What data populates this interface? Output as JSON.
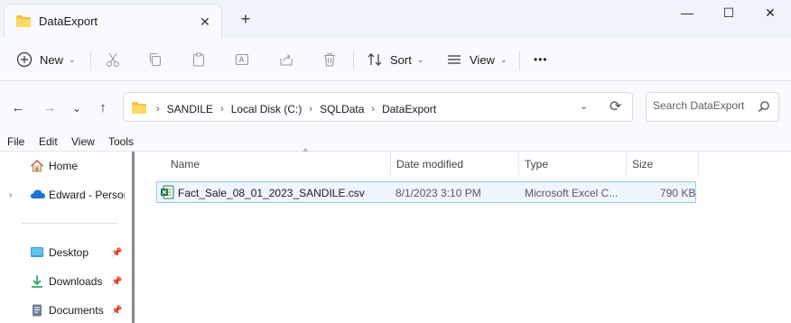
{
  "window": {
    "tab_title": "DataExport",
    "tab_close": "✕",
    "new_tab": "+",
    "minimize": "—",
    "maximize": "☐",
    "close": "✕"
  },
  "command_bar": {
    "new_label": "New",
    "sort_label": "Sort",
    "view_label": "View",
    "more_label": "•••",
    "icons": [
      "plus-circle-icon",
      "cut-icon",
      "copy-icon",
      "paste-icon",
      "rename-icon",
      "share-icon",
      "delete-icon",
      "sort-icon",
      "view-icon"
    ]
  },
  "address": {
    "back": "←",
    "forward": "→",
    "recent": "⌄",
    "up": "↑",
    "crumbs": [
      "SANDILE",
      "Local Disk (C:)",
      "SQLData",
      "DataExport"
    ],
    "dropdown": "⌄",
    "refresh": "⟳",
    "search_placeholder": "Search DataExport"
  },
  "menu": {
    "items": [
      "File",
      "Edit",
      "View",
      "Tools"
    ]
  },
  "nav_pane": {
    "items": [
      {
        "label": "Home",
        "icon": "home-icon"
      },
      {
        "label": "Edward - Persor",
        "icon": "onedrive-cloud-icon"
      },
      {
        "label": "Desktop",
        "icon": "desktop-icon"
      },
      {
        "label": "Downloads",
        "icon": "downloads-icon"
      },
      {
        "label": "Documents",
        "icon": "documents-icon"
      }
    ],
    "expander": "›",
    "pin": "📌"
  },
  "file_list": {
    "columns": [
      "Name",
      "Date modified",
      "Type",
      "Size"
    ],
    "sort_indicator": "^",
    "rows": [
      {
        "name": "Fact_Sale_08_01_2023_SANDILE.csv",
        "date_modified": "8/1/2023 3:10 PM",
        "type": "Microsoft Excel C...",
        "size": "790 KB",
        "icon": "excel-csv-icon"
      }
    ]
  },
  "colors": {
    "accent_folder": "#f5c342",
    "selection_bg": "#eef5fd",
    "selection_border": "#99c5ef",
    "excel_green": "#1d7a43",
    "onedrive_blue": "#1f73d6"
  }
}
